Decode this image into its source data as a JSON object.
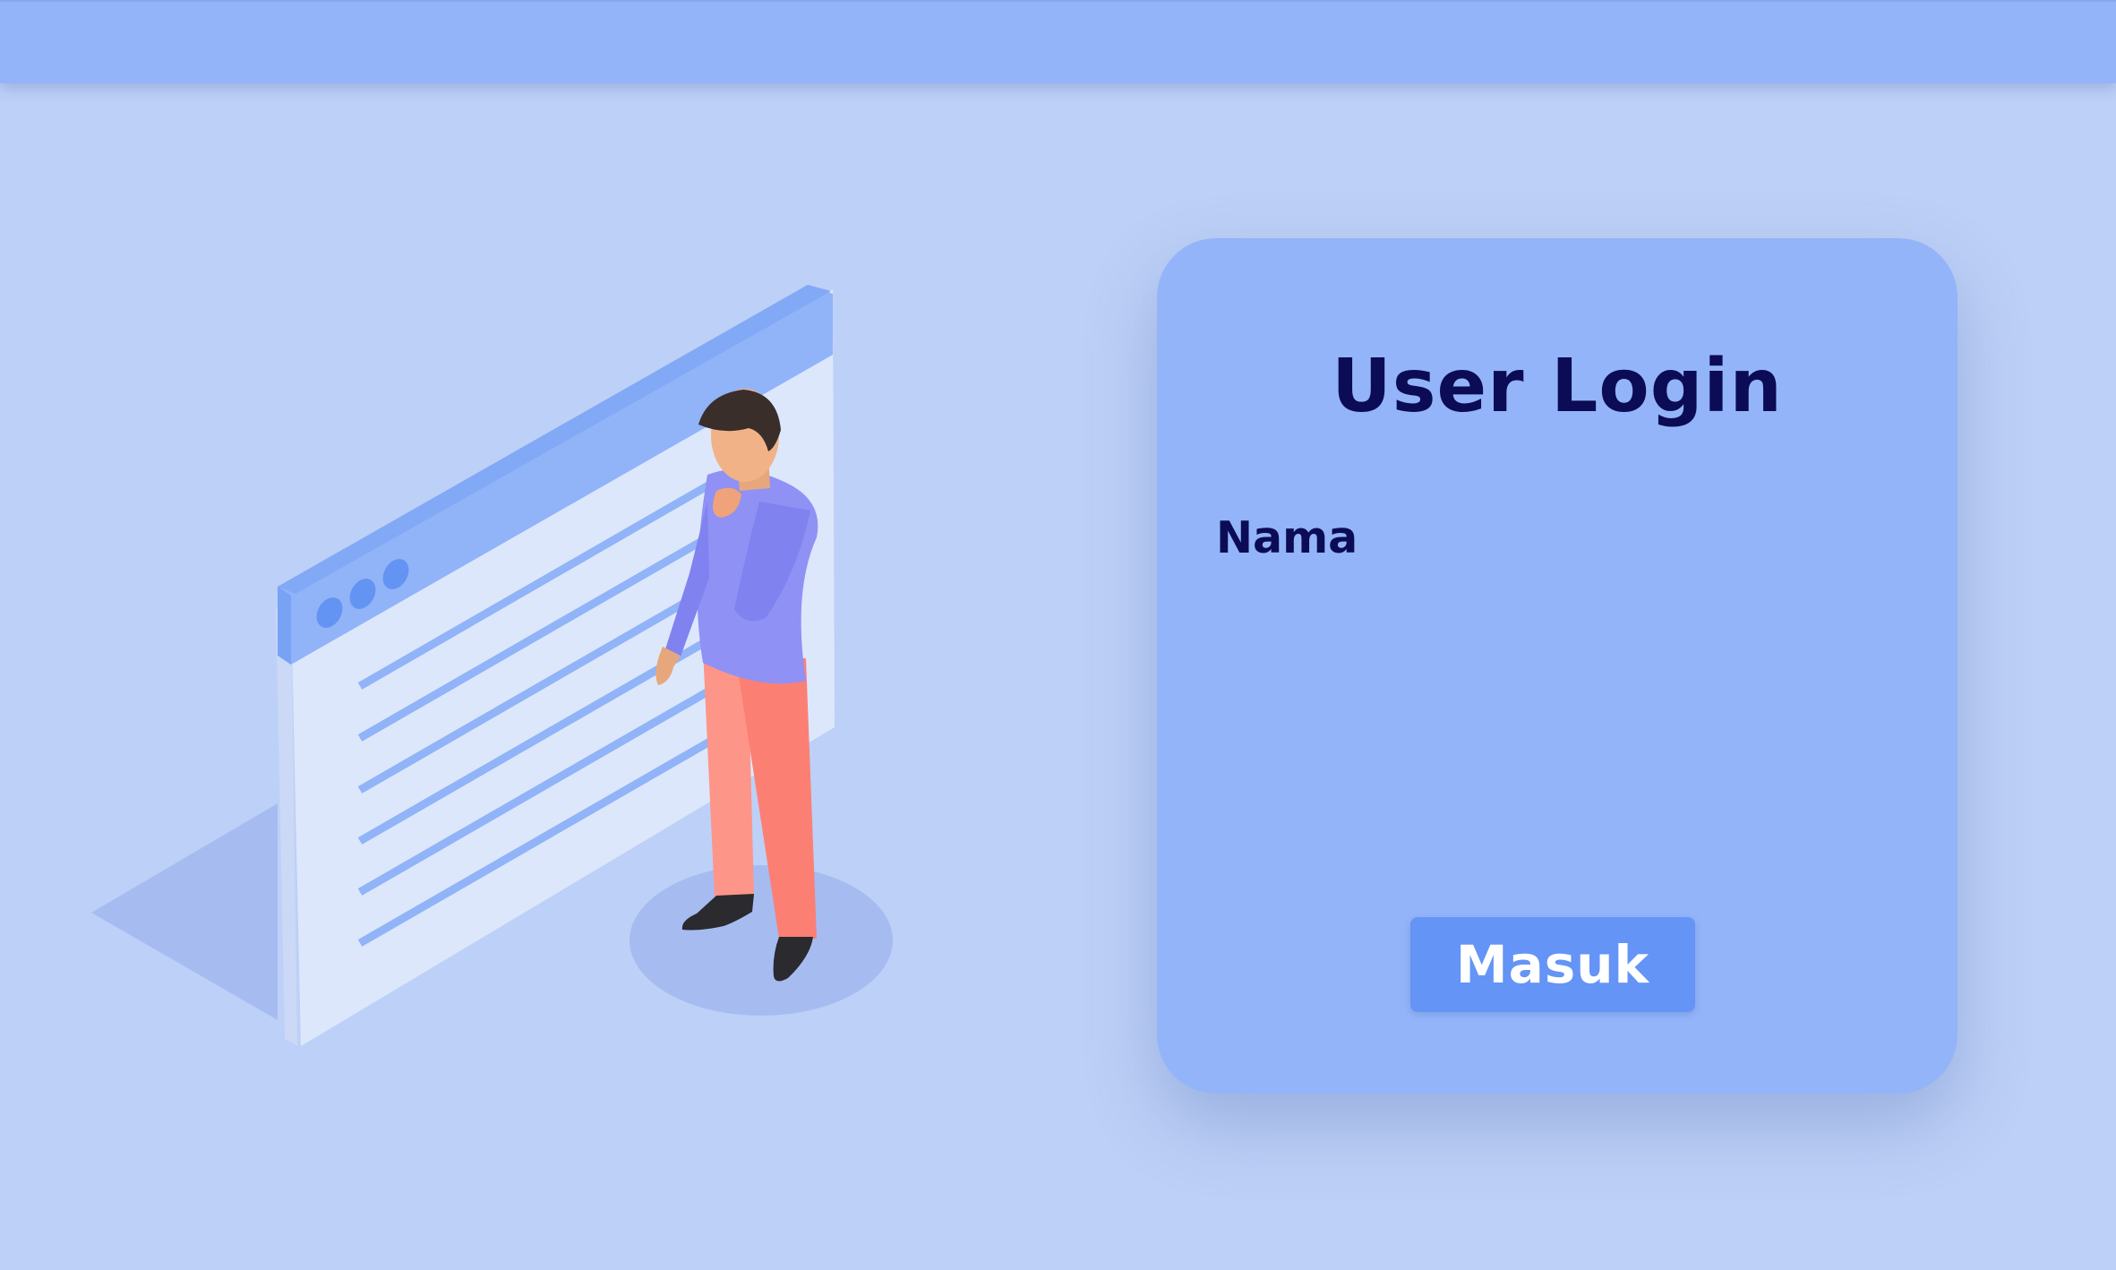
{
  "colors": {
    "background": "#bdd0f7",
    "top_bar": "#93b4f9",
    "card": "#93b4f9",
    "title_text": "#0b0c55",
    "button": "#6494f5",
    "button_text": "#ffffff"
  },
  "illustration": {
    "icon": "person-thinking-at-browser-window-illustration"
  },
  "login": {
    "title": "User Login",
    "fields": [
      {
        "label": "Nama",
        "value": "",
        "placeholder": ""
      }
    ],
    "submit_label": "Masuk"
  }
}
